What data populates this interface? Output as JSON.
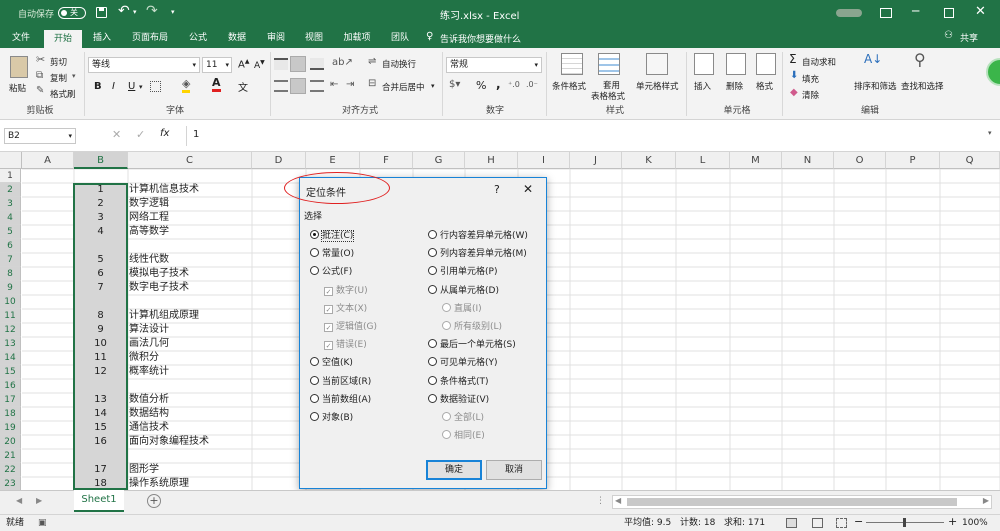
{
  "titlebar": {
    "autosave_label": "自动保存",
    "toggle_state": "关",
    "title": "练习.xlsx  -  Excel"
  },
  "menu": {
    "tabs": [
      "文件",
      "开始",
      "插入",
      "页面布局",
      "公式",
      "数据",
      "审阅",
      "视图",
      "加载项",
      "团队"
    ],
    "tell_me": "告诉我你想要做什么",
    "share": "共享"
  },
  "ribbon": {
    "clipboard": {
      "paste": "粘贴",
      "cut": "剪切",
      "copy": "复制",
      "format_painter": "格式刷",
      "group": "剪贴板"
    },
    "font": {
      "name": "等线",
      "size": "11",
      "bold": "B",
      "italic": "I",
      "underline": "U",
      "group": "字体"
    },
    "alignment": {
      "wrap": "自动换行",
      "merge": "合并后居中",
      "group": "对齐方式"
    },
    "number": {
      "format": "常规",
      "percent": "%",
      "comma": ",",
      "group": "数字"
    },
    "styles": {
      "conditional": "条件格式",
      "table_line1": "套用",
      "table_line2": "表格格式",
      "cell_styles": "单元格样式",
      "group": "样式"
    },
    "cells": {
      "insert": "插入",
      "delete": "删除",
      "format": "格式",
      "group": "单元格"
    },
    "editing": {
      "autosum": "自动求和",
      "fill": "填充",
      "clear": "清除",
      "sort": "排序和筛选",
      "find": "查找和选择",
      "group": "编辑"
    }
  },
  "formula_bar": {
    "name_box": "B2",
    "fx": "fx",
    "value": "1"
  },
  "columns": [
    "A",
    "B",
    "C",
    "D",
    "E",
    "F",
    "G",
    "H",
    "I",
    "J",
    "K",
    "L",
    "M",
    "N",
    "O",
    "P",
    "Q"
  ],
  "rows": [
    "1",
    "2",
    "3",
    "4",
    "5",
    "6",
    "7",
    "8",
    "9",
    "10",
    "11",
    "12",
    "13",
    "14",
    "15",
    "16",
    "17",
    "18",
    "19",
    "20",
    "21",
    "22",
    "23"
  ],
  "cells": [
    {
      "row": 2,
      "b": "1",
      "c": "计算机信息技术"
    },
    {
      "row": 3,
      "b": "2",
      "c": "数字逻辑"
    },
    {
      "row": 4,
      "b": "3",
      "c": "网络工程"
    },
    {
      "row": 5,
      "b": "4",
      "c": "高等数学"
    },
    {
      "row": 7,
      "b": "5",
      "c": "线性代数"
    },
    {
      "row": 8,
      "b": "6",
      "c": "模拟电子技术"
    },
    {
      "row": 9,
      "b": "7",
      "c": "数字电子技术"
    },
    {
      "row": 11,
      "b": "8",
      "c": "计算机组成原理"
    },
    {
      "row": 12,
      "b": "9",
      "c": "算法设计"
    },
    {
      "row": 13,
      "b": "10",
      "c": "画法几何"
    },
    {
      "row": 14,
      "b": "11",
      "c": "微积分"
    },
    {
      "row": 15,
      "b": "12",
      "c": "概率统计"
    },
    {
      "row": 17,
      "b": "13",
      "c": "数值分析"
    },
    {
      "row": 18,
      "b": "14",
      "c": "数据结构"
    },
    {
      "row": 19,
      "b": "15",
      "c": "通信技术"
    },
    {
      "row": 20,
      "b": "16",
      "c": "面向对象编程技术"
    },
    {
      "row": 22,
      "b": "17",
      "c": "图形学"
    },
    {
      "row": 23,
      "b": "18",
      "c": "操作系统原理"
    }
  ],
  "dialog": {
    "title": "定位条件",
    "help": "?",
    "close": "✕",
    "section": "选择",
    "left": [
      {
        "label": "批注(C)",
        "type": "radio",
        "checked": true
      },
      {
        "label": "常量(O)",
        "type": "radio"
      },
      {
        "label": "公式(F)",
        "type": "radio"
      },
      {
        "label": "数字(U)",
        "type": "check",
        "disabled": true,
        "indent": true
      },
      {
        "label": "文本(X)",
        "type": "check",
        "disabled": true,
        "indent": true
      },
      {
        "label": "逻辑值(G)",
        "type": "check",
        "disabled": true,
        "indent": true
      },
      {
        "label": "错误(E)",
        "type": "check",
        "disabled": true,
        "indent": true
      },
      {
        "label": "空值(K)",
        "type": "radio"
      },
      {
        "label": "当前区域(R)",
        "type": "radio"
      },
      {
        "label": "当前数组(A)",
        "type": "radio"
      },
      {
        "label": "对象(B)",
        "type": "radio"
      }
    ],
    "right": [
      {
        "label": "行内容差异单元格(W)",
        "type": "radio"
      },
      {
        "label": "列内容差异单元格(M)",
        "type": "radio"
      },
      {
        "label": "引用单元格(P)",
        "type": "radio"
      },
      {
        "label": "从属单元格(D)",
        "type": "radio"
      },
      {
        "label": "直属(I)",
        "type": "radio",
        "disabled": true,
        "indent": true
      },
      {
        "label": "所有级别(L)",
        "type": "radio",
        "disabled": true,
        "indent": true
      },
      {
        "label": "最后一个单元格(S)",
        "type": "radio"
      },
      {
        "label": "可见单元格(Y)",
        "type": "radio"
      },
      {
        "label": "条件格式(T)",
        "type": "radio"
      },
      {
        "label": "数据验证(V)",
        "type": "radio"
      },
      {
        "label": "全部(L)",
        "type": "radio",
        "disabled": true,
        "indent": true
      },
      {
        "label": "相同(E)",
        "type": "radio",
        "disabled": true,
        "indent": true
      }
    ],
    "ok": "确定",
    "cancel": "取消"
  },
  "sheet_tab": "Sheet1",
  "add_sheet": "+",
  "status": {
    "ready": "就绪",
    "average": "平均值: 9.5",
    "count": "计数: 18",
    "sum": "求和: 171",
    "zoom": "100%"
  },
  "colors": {
    "excel_green": "#217346",
    "highlight_red": "#e02020",
    "dialog_border": "#1883d7"
  }
}
